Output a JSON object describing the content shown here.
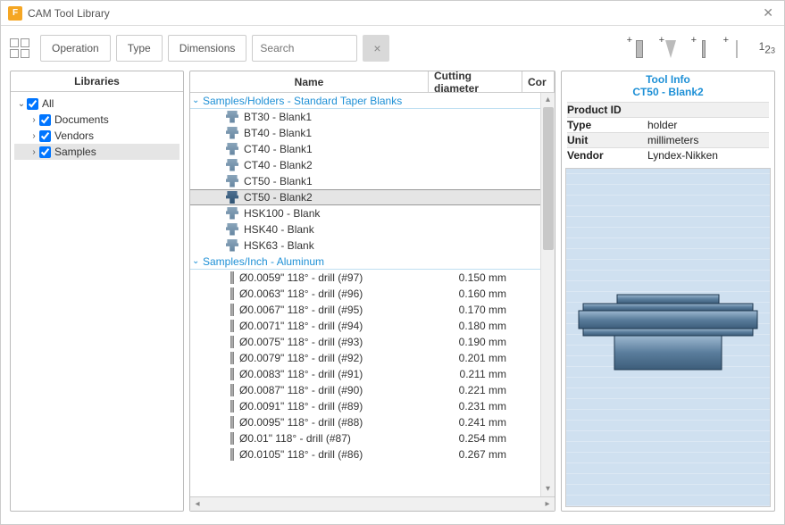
{
  "window": {
    "title": "CAM Tool Library"
  },
  "toolbar": {
    "operation": "Operation",
    "type": "Type",
    "dimensions": "Dimensions",
    "search_placeholder": "Search",
    "clear": "×"
  },
  "left": {
    "header": "Libraries",
    "all": "All",
    "items": [
      "Documents",
      "Vendors",
      "Samples"
    ],
    "selected_index": 2
  },
  "center": {
    "columns": {
      "name": "Name",
      "cutting": "Cutting diameter",
      "corner": "Cor"
    },
    "groups": [
      {
        "label": "Samples/Holders - Standard Taper Blanks",
        "kind": "holder",
        "rows": [
          {
            "name": "BT30 - Blank1"
          },
          {
            "name": "BT40 - Blank1"
          },
          {
            "name": "CT40 - Blank1"
          },
          {
            "name": "CT40 - Blank2"
          },
          {
            "name": "CT50 - Blank1"
          },
          {
            "name": "CT50 - Blank2",
            "selected": true
          },
          {
            "name": "HSK100 - Blank"
          },
          {
            "name": "HSK40 - Blank"
          },
          {
            "name": "HSK63 - Blank"
          }
        ]
      },
      {
        "label": "Samples/Inch - Aluminum",
        "kind": "drill",
        "rows": [
          {
            "name": "Ø0.0059\" 118° - drill (#97)",
            "cut": "0.150 mm"
          },
          {
            "name": "Ø0.0063\" 118° - drill (#96)",
            "cut": "0.160 mm"
          },
          {
            "name": "Ø0.0067\" 118° - drill (#95)",
            "cut": "0.170 mm"
          },
          {
            "name": "Ø0.0071\" 118° - drill (#94)",
            "cut": "0.180 mm"
          },
          {
            "name": "Ø0.0075\" 118° - drill (#93)",
            "cut": "0.190 mm"
          },
          {
            "name": "Ø0.0079\" 118° - drill (#92)",
            "cut": "0.201 mm"
          },
          {
            "name": "Ø0.0083\" 118° - drill (#91)",
            "cut": "0.211 mm"
          },
          {
            "name": "Ø0.0087\" 118° - drill (#90)",
            "cut": "0.221 mm"
          },
          {
            "name": "Ø0.0091\" 118° - drill (#89)",
            "cut": "0.231 mm"
          },
          {
            "name": "Ø0.0095\" 118° - drill (#88)",
            "cut": "0.241 mm"
          },
          {
            "name": "Ø0.01\" 118° - drill (#87)",
            "cut": "0.254 mm"
          },
          {
            "name": "Ø0.0105\" 118° - drill (#86)",
            "cut": "0.267 mm"
          }
        ]
      }
    ]
  },
  "info": {
    "title": "Tool Info",
    "subtitle": "CT50 - Blank2",
    "rows": [
      {
        "k": "Product ID",
        "v": ""
      },
      {
        "k": "Type",
        "v": "holder"
      },
      {
        "k": "Unit",
        "v": "millimeters"
      },
      {
        "k": "Vendor",
        "v": "Lyndex-Nikken"
      }
    ]
  }
}
